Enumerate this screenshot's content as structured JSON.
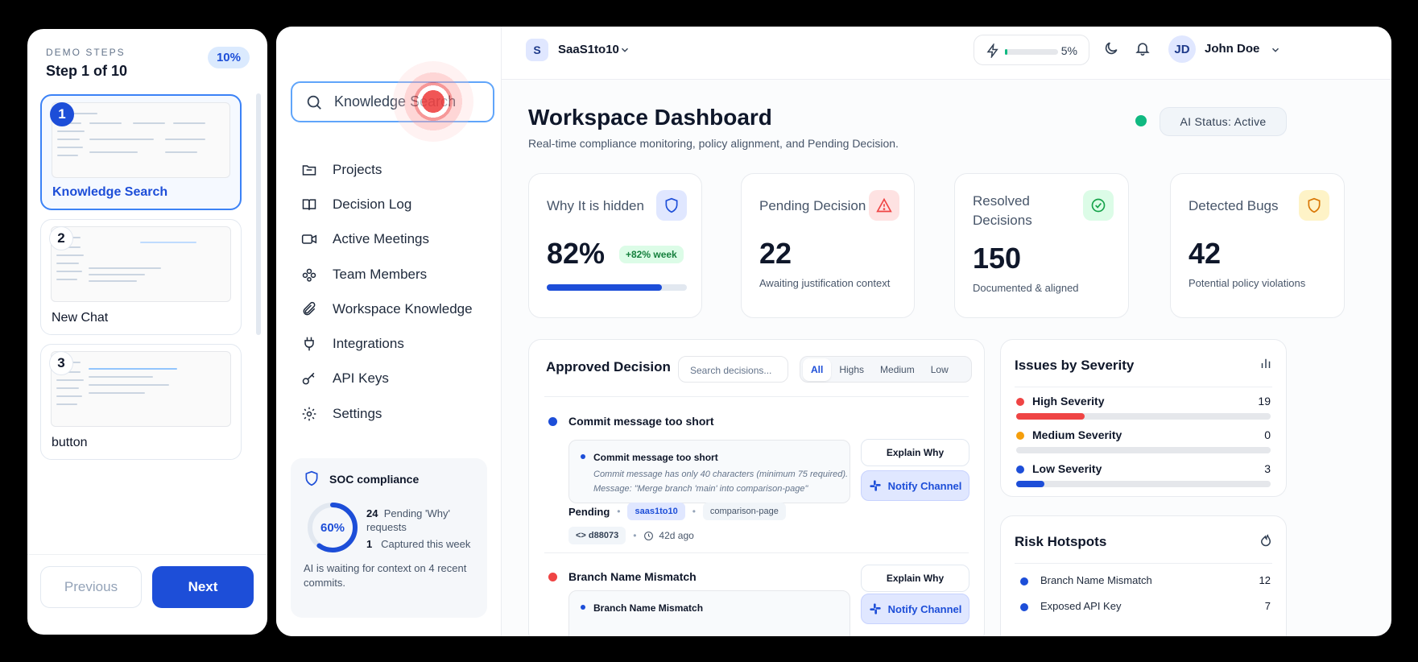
{
  "demo_steps": {
    "kicker": "DEMO STEPS",
    "title": "Step 1 of 10",
    "progress_badge": "10%",
    "steps": [
      {
        "number": "1",
        "label": "Knowledge Search",
        "active": true
      },
      {
        "number": "2",
        "label": "New Chat",
        "active": false
      },
      {
        "number": "3",
        "label": "button",
        "active": false
      }
    ],
    "previous_label": "Previous",
    "next_label": "Next"
  },
  "sidebar": {
    "search_value": "Knowledge Search",
    "items": [
      {
        "label": "Projects",
        "icon": "folder-icon"
      },
      {
        "label": "Decision Log",
        "icon": "book-icon"
      },
      {
        "label": "Active Meetings",
        "icon": "video-icon"
      },
      {
        "label": "Team Members",
        "icon": "users-icon"
      },
      {
        "label": "Workspace Knowledge",
        "icon": "paperclip-icon"
      },
      {
        "label": "Integrations",
        "icon": "plug-icon"
      },
      {
        "label": "API Keys",
        "icon": "key-icon"
      },
      {
        "label": "Settings",
        "icon": "gear-icon"
      }
    ],
    "soc": {
      "title": "SOC compliance",
      "percent_label": "60%",
      "percent": 60,
      "pending_count": "24",
      "pending_text": "Pending 'Why' requests",
      "captured_count": "1",
      "captured_text": "Captured this week",
      "footer": "AI is waiting for context on 4 recent commits."
    }
  },
  "topbar": {
    "workspace_initial": "S",
    "workspace_name": "SaaS1to10",
    "usage_label": "5%",
    "usage_percent": 5,
    "user_initials": "JD",
    "user_name": "John Doe"
  },
  "header": {
    "title": "Workspace Dashboard",
    "subtitle": "Real-time compliance monitoring, policy alignment, and Pending Decision.",
    "ai_status": "AI Status: Active"
  },
  "stats": [
    {
      "label": "Why It is hidden",
      "value": "82%",
      "trend": "+82% week",
      "progress": 82,
      "icon": "shield-icon"
    },
    {
      "label": "Pending Decision",
      "value": "22",
      "sub": "Awaiting justification context",
      "icon": "warning-icon"
    },
    {
      "label": "Resolved Decisions",
      "value": "150",
      "sub": "Documented & aligned",
      "icon": "check-circle-icon"
    },
    {
      "label": "Detected Bugs",
      "value": "42",
      "sub": "Potential policy violations",
      "icon": "shield-icon"
    }
  ],
  "approved": {
    "title": "Approved Decision",
    "search_placeholder": "Search decisions...",
    "filters": [
      "All",
      "Highs",
      "Medium",
      "Low"
    ],
    "active_filter": "All",
    "explain_label": "Explain Why",
    "notify_label": "Notify Channel",
    "decisions": [
      {
        "title": "Commit message too short",
        "box_title": "Commit message too short",
        "box_line1": "Commit message has only 40 characters (minimum 75 required).",
        "box_line2": "Message: \"Merge branch 'main' into comparison-page\"",
        "status": "Pending",
        "repo": "saas1to10",
        "branch": "comparison-page",
        "commit": "d88073",
        "age": "42d ago",
        "color": "#1d4ed8"
      },
      {
        "title": "Branch Name Mismatch",
        "box_title": "Branch Name Mismatch",
        "color": "#ef4444"
      }
    ]
  },
  "severity": {
    "title": "Issues by Severity",
    "rows": [
      {
        "name": "High Severity",
        "count": "19",
        "fraction": 0.27,
        "color": "#ef4444"
      },
      {
        "name": "Medium Severity",
        "count": "0",
        "fraction": 0,
        "color": "#f59e0b"
      },
      {
        "name": "Low Severity",
        "count": "3",
        "fraction": 0.11,
        "color": "#1d4ed8"
      }
    ]
  },
  "hotspots": {
    "title": "Risk Hotspots",
    "rows": [
      {
        "name": "Branch Name Mismatch",
        "count": "12"
      },
      {
        "name": "Exposed API Key",
        "count": "7"
      }
    ]
  }
}
